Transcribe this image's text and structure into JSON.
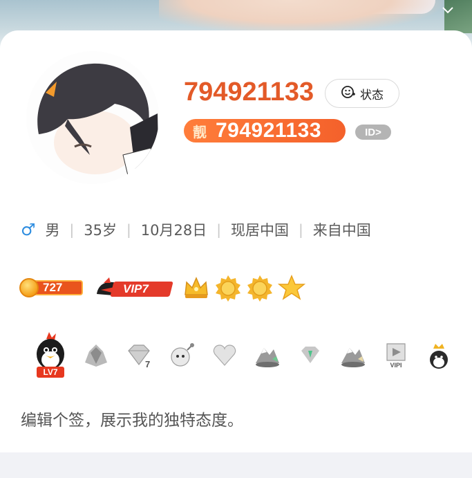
{
  "profile": {
    "username": "794921133",
    "status_label": "状态",
    "pretty_id_prefix": "靓",
    "pretty_id": "794921133",
    "id_button": "ID>"
  },
  "info": {
    "gender": "男",
    "age": "35岁",
    "birthday": "10月28日",
    "residence": "现居中国",
    "hometown": "来自中国"
  },
  "levels": {
    "coin_count": "727",
    "vip_label": "VIP7",
    "level_icons": [
      "crown-icon",
      "sun-icon",
      "sun-icon",
      "star-icon"
    ]
  },
  "badges": {
    "qq_level_label": "LV7",
    "vip_badge_label": "VIPI"
  },
  "signature": "编辑个签，展示我的独特态度。",
  "colors": {
    "username": "#e35a28",
    "pretty_badge": "#f4612b",
    "male": "#2e8de0",
    "vip": "#e43a2a"
  }
}
